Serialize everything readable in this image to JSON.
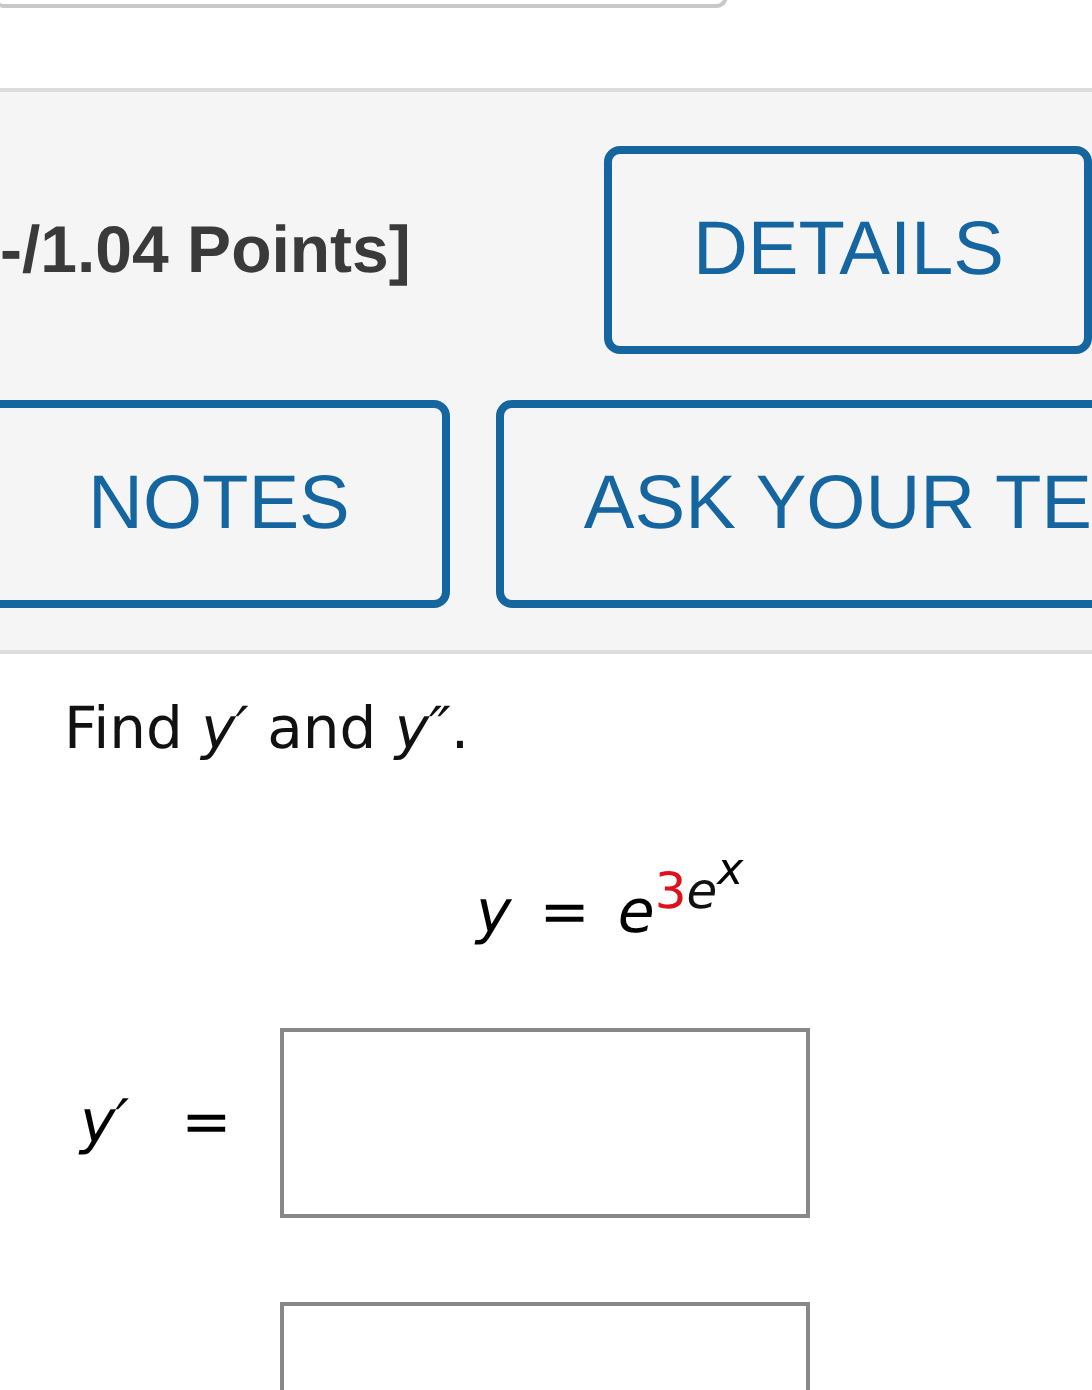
{
  "header": {
    "points": "-/1.04 Points]",
    "buttons": [
      {
        "label": "DETAILS"
      },
      {
        "label": "NOTES"
      },
      {
        "label": "ASK YOUR TE"
      }
    ]
  },
  "question": {
    "prompt": "Find *y′* and *y″*.",
    "equation": {
      "lhs": "y",
      "relation": "=",
      "base": "e",
      "exponent": [
        {
          "text": "3",
          "highlight": true
        },
        {
          "text": "e",
          "highlight": false
        }
      ],
      "inner_exponent": "x"
    }
  },
  "answers": [
    {
      "kind": "labeled",
      "label": "y′",
      "relation": "="
    },
    {
      "kind": "bare"
    }
  ]
}
